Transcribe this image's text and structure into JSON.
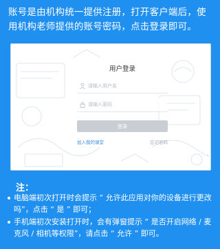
{
  "intro_text": "账号是由机构统一提供注册，打开客户端后，使用机构老师提供的账号密码，点击登录即可。",
  "login": {
    "title": "用户登录",
    "username_placeholder": "请输入用户名",
    "password_placeholder": "请输入密码",
    "login_button": "登录",
    "join_link": "加入我的课堂",
    "forgot_link": "忘记密码"
  },
  "notes": {
    "title": "注：",
    "items": [
      "电脑端初次打开时会提示 “ 允许此应用对你的设备进行更改吗”，点击 “ 是 ” 即可；",
      "手机端初次安装打开时，会有弹窗提示 “ 是否开启网络 / 麦克风 / 相机等权限”，请点击 “ 允许 ” 即可。"
    ]
  },
  "icons": {
    "user_field": "user-icon",
    "password_field": "lock-icon"
  },
  "colors": {
    "background": "#1f8ff0",
    "card": "#ffffff",
    "login_button": "#c9ced4",
    "link": "#3a8ee6"
  }
}
